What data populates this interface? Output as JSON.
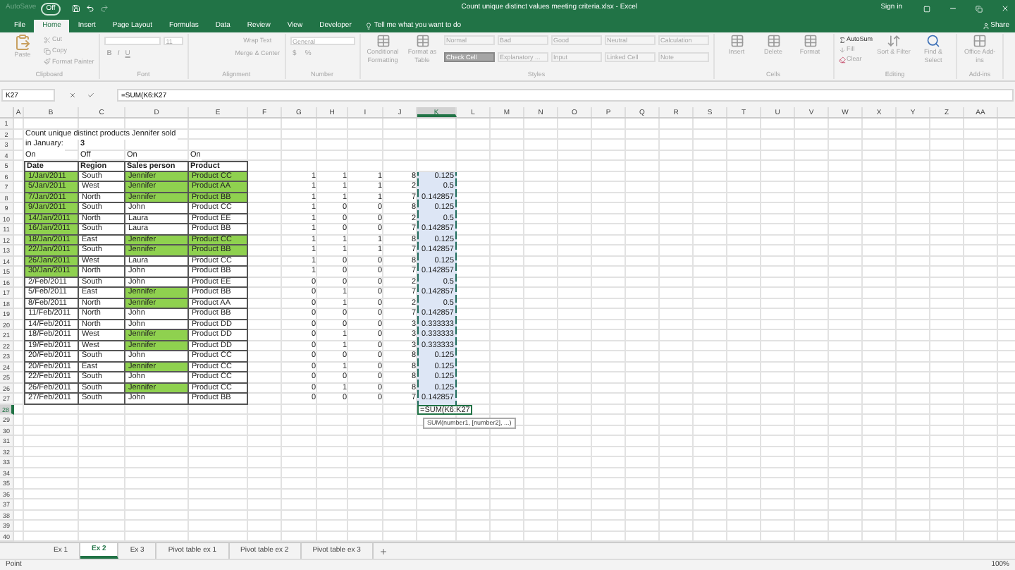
{
  "title_bar": {
    "autosave_label": "AutoSave",
    "autosave_state": "Off",
    "title": "Count unique distinct values meeting criteria.xlsx - Excel",
    "sign_in": "Sign in"
  },
  "ribbon_tabs": [
    {
      "label": "File",
      "selected": false
    },
    {
      "label": "Home",
      "selected": true
    },
    {
      "label": "Insert",
      "selected": false
    },
    {
      "label": "Page Layout",
      "selected": false
    },
    {
      "label": "Formulas",
      "selected": false
    },
    {
      "label": "Data",
      "selected": false
    },
    {
      "label": "Review",
      "selected": false
    },
    {
      "label": "View",
      "selected": false
    },
    {
      "label": "Developer",
      "selected": false
    }
  ],
  "tell_me": "Tell me what you want to do",
  "share": "Share",
  "ribbon": {
    "disabled": true,
    "groups": [
      {
        "kind": "clipboard",
        "label": "Clipboard",
        "big": [
          "Paste"
        ],
        "items": [
          "Cut",
          "Copy",
          "Format Painter"
        ]
      },
      {
        "kind": "font",
        "label": "Font",
        "size": "11",
        "buttons": [
          "B",
          "I",
          "U"
        ]
      },
      {
        "kind": "alignment",
        "label": "Alignment",
        "items": [
          "Wrap Text",
          "Merge & Center"
        ]
      },
      {
        "kind": "number",
        "label": "Number",
        "format": "General",
        "buttons": [
          "$",
          "%"
        ]
      },
      {
        "kind": "styles",
        "label": "Styles",
        "big": [
          "Conditional Formatting",
          "Format as Table"
        ],
        "styles": [
          {
            "label": "Normal",
            "selected": false
          },
          {
            "label": "Bad",
            "selected": false
          },
          {
            "label": "Good",
            "selected": false
          },
          {
            "label": "Neutral",
            "selected": false
          },
          {
            "label": "Calculation",
            "selected": false
          },
          {
            "label": "Check Cell",
            "selected": true
          },
          {
            "label": "Explanatory ...",
            "selected": false
          },
          {
            "label": "Input",
            "selected": false
          },
          {
            "label": "Linked Cell",
            "selected": false
          },
          {
            "label": "Note",
            "selected": false
          }
        ]
      },
      {
        "kind": "cells",
        "label": "Cells",
        "big": [
          "Insert",
          "Delete",
          "Format"
        ]
      },
      {
        "kind": "editing",
        "label": "Editing",
        "items": [
          "AutoSum",
          "Fill",
          "Clear"
        ],
        "big": [
          "Sort & Filter",
          "Find & Select"
        ]
      },
      {
        "kind": "addins",
        "label": "Add-ins",
        "big": [
          "Office Add-ins"
        ]
      }
    ]
  },
  "formula_bar": {
    "name_box": "K27",
    "formula": "=SUM(K6:K27"
  },
  "sheet": {
    "column_headers": [
      {
        "label": "A",
        "selected": false
      },
      {
        "label": "B",
        "selected": false
      },
      {
        "label": "C",
        "selected": false
      },
      {
        "label": "D",
        "selected": false
      },
      {
        "label": "E",
        "selected": false
      },
      {
        "label": "F",
        "selected": false
      },
      {
        "label": "G",
        "selected": false
      },
      {
        "label": "H",
        "selected": false
      },
      {
        "label": "I",
        "selected": false
      },
      {
        "label": "J",
        "selected": false
      },
      {
        "label": "K",
        "selected": true
      },
      {
        "label": "L",
        "selected": false
      },
      {
        "label": "M",
        "selected": false
      },
      {
        "label": "N",
        "selected": false
      },
      {
        "label": "O",
        "selected": false
      },
      {
        "label": "P",
        "selected": false
      },
      {
        "label": "Q",
        "selected": false
      },
      {
        "label": "R",
        "selected": false
      },
      {
        "label": "S",
        "selected": false
      },
      {
        "label": "T",
        "selected": false
      },
      {
        "label": "U",
        "selected": false
      },
      {
        "label": "V",
        "selected": false
      },
      {
        "label": "W",
        "selected": false
      },
      {
        "label": "X",
        "selected": false
      },
      {
        "label": "Y",
        "selected": false
      },
      {
        "label": "Z",
        "selected": false
      },
      {
        "label": "AA",
        "selected": false
      }
    ],
    "rows": [
      {
        "header": "1",
        "selected": false,
        "kind": "blank"
      },
      {
        "header": "2",
        "selected": false,
        "kind": "note",
        "note": "Count unique distinct products  Jennifer sold"
      },
      {
        "header": "3",
        "selected": false,
        "kind": "result",
        "note": "in January:",
        "result": "3"
      },
      {
        "header": "4",
        "selected": false,
        "kind": "toggles",
        "toggles": [
          "On",
          "Off",
          "On",
          "On"
        ]
      },
      {
        "header": "5",
        "selected": false,
        "kind": "table_header",
        "labels": [
          "Date",
          "Region",
          "Sales person",
          "Product"
        ]
      },
      {
        "header": "6",
        "selected": false,
        "kind": "record",
        "marked": true,
        "record": [
          {
            "text": "1/Jan/2011",
            "highlighted": true
          },
          {
            "text": "South",
            "highlighted": false
          },
          {
            "text": "Jennifer",
            "highlighted": true
          },
          {
            "text": "Product CC",
            "highlighted": true
          }
        ],
        "helpers": [
          "1",
          "1",
          "1",
          "8",
          "0.125"
        ]
      },
      {
        "header": "7",
        "selected": false,
        "kind": "record",
        "marked": true,
        "record": [
          {
            "text": "5/Jan/2011",
            "highlighted": true
          },
          {
            "text": "West",
            "highlighted": false
          },
          {
            "text": "Jennifer",
            "highlighted": true
          },
          {
            "text": "Product AA",
            "highlighted": true
          }
        ],
        "helpers": [
          "1",
          "1",
          "1",
          "2",
          "0.5"
        ]
      },
      {
        "header": "8",
        "selected": false,
        "kind": "record",
        "marked": true,
        "record": [
          {
            "text": "7/Jan/2011",
            "highlighted": true
          },
          {
            "text": "North",
            "highlighted": false
          },
          {
            "text": "Jennifer",
            "highlighted": true
          },
          {
            "text": "Product BB",
            "highlighted": true
          }
        ],
        "helpers": [
          "1",
          "1",
          "1",
          "7",
          "0.142857"
        ]
      },
      {
        "header": "9",
        "selected": false,
        "kind": "record",
        "marked": true,
        "record": [
          {
            "text": "9/Jan/2011",
            "highlighted": true
          },
          {
            "text": "South",
            "highlighted": false
          },
          {
            "text": "John",
            "highlighted": false
          },
          {
            "text": "Product CC",
            "highlighted": false
          }
        ],
        "helpers": [
          "1",
          "0",
          "0",
          "8",
          "0.125"
        ]
      },
      {
        "header": "10",
        "selected": false,
        "kind": "record",
        "marked": true,
        "record": [
          {
            "text": "14/Jan/2011",
            "highlighted": true
          },
          {
            "text": "North",
            "highlighted": false
          },
          {
            "text": "Laura",
            "highlighted": false
          },
          {
            "text": "Product EE",
            "highlighted": false
          }
        ],
        "helpers": [
          "1",
          "0",
          "0",
          "2",
          "0.5"
        ]
      },
      {
        "header": "11",
        "selected": false,
        "kind": "record",
        "marked": true,
        "record": [
          {
            "text": "16/Jan/2011",
            "highlighted": true
          },
          {
            "text": "South",
            "highlighted": false
          },
          {
            "text": "Laura",
            "highlighted": false
          },
          {
            "text": "Product BB",
            "highlighted": false
          }
        ],
        "helpers": [
          "1",
          "0",
          "0",
          "7",
          "0.142857"
        ]
      },
      {
        "header": "12",
        "selected": false,
        "kind": "record",
        "marked": true,
        "record": [
          {
            "text": "18/Jan/2011",
            "highlighted": true
          },
          {
            "text": "East",
            "highlighted": false
          },
          {
            "text": "Jennifer",
            "highlighted": true
          },
          {
            "text": "Product CC",
            "highlighted": true
          }
        ],
        "helpers": [
          "1",
          "1",
          "1",
          "8",
          "0.125"
        ]
      },
      {
        "header": "13",
        "selected": false,
        "kind": "record",
        "marked": true,
        "record": [
          {
            "text": "22/Jan/2011",
            "highlighted": true
          },
          {
            "text": "South",
            "highlighted": false
          },
          {
            "text": "Jennifer",
            "highlighted": true
          },
          {
            "text": "Product BB",
            "highlighted": true
          }
        ],
        "helpers": [
          "1",
          "1",
          "1",
          "7",
          "0.142857"
        ]
      },
      {
        "header": "14",
        "selected": false,
        "kind": "record",
        "marked": true,
        "record": [
          {
            "text": "26/Jan/2011",
            "highlighted": true
          },
          {
            "text": "West",
            "highlighted": false
          },
          {
            "text": "Laura",
            "highlighted": false
          },
          {
            "text": "Product CC",
            "highlighted": false
          }
        ],
        "helpers": [
          "1",
          "0",
          "0",
          "8",
          "0.125"
        ]
      },
      {
        "header": "15",
        "selected": false,
        "kind": "record",
        "marked": true,
        "record": [
          {
            "text": "30/Jan/2011",
            "highlighted": true
          },
          {
            "text": "North",
            "highlighted": false
          },
          {
            "text": "John",
            "highlighted": false
          },
          {
            "text": "Product BB",
            "highlighted": false
          }
        ],
        "helpers": [
          "1",
          "0",
          "0",
          "7",
          "0.142857"
        ]
      },
      {
        "header": "16",
        "selected": false,
        "kind": "record",
        "marked": true,
        "record": [
          {
            "text": "2/Feb/2011",
            "highlighted": false
          },
          {
            "text": "South",
            "highlighted": false
          },
          {
            "text": "John",
            "highlighted": false
          },
          {
            "text": "Product EE",
            "highlighted": false
          }
        ],
        "helpers": [
          "0",
          "0",
          "0",
          "2",
          "0.5"
        ]
      },
      {
        "header": "17",
        "selected": false,
        "kind": "record",
        "marked": true,
        "record": [
          {
            "text": "5/Feb/2011",
            "highlighted": false
          },
          {
            "text": "East",
            "highlighted": false
          },
          {
            "text": "Jennifer",
            "highlighted": true
          },
          {
            "text": "Product BB",
            "highlighted": false
          }
        ],
        "helpers": [
          "0",
          "1",
          "0",
          "7",
          "0.142857"
        ]
      },
      {
        "header": "18",
        "selected": false,
        "kind": "record",
        "marked": true,
        "record": [
          {
            "text": "8/Feb/2011",
            "highlighted": false
          },
          {
            "text": "North",
            "highlighted": false
          },
          {
            "text": "Jennifer",
            "highlighted": true
          },
          {
            "text": "Product AA",
            "highlighted": false
          }
        ],
        "helpers": [
          "0",
          "1",
          "0",
          "2",
          "0.5"
        ]
      },
      {
        "header": "19",
        "selected": false,
        "kind": "record",
        "marked": true,
        "record": [
          {
            "text": "11/Feb/2011",
            "highlighted": false
          },
          {
            "text": "North",
            "highlighted": false
          },
          {
            "text": "John",
            "highlighted": false
          },
          {
            "text": "Product BB",
            "highlighted": false
          }
        ],
        "helpers": [
          "0",
          "0",
          "0",
          "7",
          "0.142857"
        ]
      },
      {
        "header": "20",
        "selected": false,
        "kind": "record",
        "marked": true,
        "record": [
          {
            "text": "14/Feb/2011",
            "highlighted": false
          },
          {
            "text": "North",
            "highlighted": false
          },
          {
            "text": "John",
            "highlighted": false
          },
          {
            "text": "Product DD",
            "highlighted": false
          }
        ],
        "helpers": [
          "0",
          "0",
          "0",
          "3",
          "0.333333"
        ]
      },
      {
        "header": "21",
        "selected": false,
        "kind": "record",
        "marked": true,
        "record": [
          {
            "text": "18/Feb/2011",
            "highlighted": false
          },
          {
            "text": "West",
            "highlighted": false
          },
          {
            "text": "Jennifer",
            "highlighted": true
          },
          {
            "text": "Product DD",
            "highlighted": false
          }
        ],
        "helpers": [
          "0",
          "1",
          "0",
          "3",
          "0.333333"
        ]
      },
      {
        "header": "22",
        "selected": false,
        "kind": "record",
        "marked": true,
        "record": [
          {
            "text": "19/Feb/2011",
            "highlighted": false
          },
          {
            "text": "West",
            "highlighted": false
          },
          {
            "text": "Jennifer",
            "highlighted": true
          },
          {
            "text": "Product DD",
            "highlighted": false
          }
        ],
        "helpers": [
          "0",
          "1",
          "0",
          "3",
          "0.333333"
        ]
      },
      {
        "header": "23",
        "selected": false,
        "kind": "record",
        "marked": true,
        "record": [
          {
            "text": "20/Feb/2011",
            "highlighted": false
          },
          {
            "text": "South",
            "highlighted": false
          },
          {
            "text": "John",
            "highlighted": false
          },
          {
            "text": "Product CC",
            "highlighted": false
          }
        ],
        "helpers": [
          "0",
          "0",
          "0",
          "8",
          "0.125"
        ]
      },
      {
        "header": "24",
        "selected": false,
        "kind": "record",
        "marked": true,
        "record": [
          {
            "text": "20/Feb/2011",
            "highlighted": false
          },
          {
            "text": "East",
            "highlighted": false
          },
          {
            "text": "Jennifer",
            "highlighted": true
          },
          {
            "text": "Product CC",
            "highlighted": false
          }
        ],
        "helpers": [
          "0",
          "1",
          "0",
          "8",
          "0.125"
        ]
      },
      {
        "header": "25",
        "selected": false,
        "kind": "record",
        "marked": true,
        "record": [
          {
            "text": "22/Feb/2011",
            "highlighted": false
          },
          {
            "text": "South",
            "highlighted": false
          },
          {
            "text": "John",
            "highlighted": false
          },
          {
            "text": "Product CC",
            "highlighted": false
          }
        ],
        "helpers": [
          "0",
          "0",
          "0",
          "8",
          "0.125"
        ]
      },
      {
        "header": "26",
        "selected": false,
        "kind": "record",
        "marked": true,
        "record": [
          {
            "text": "26/Feb/2011",
            "highlighted": false
          },
          {
            "text": "South",
            "highlighted": false
          },
          {
            "text": "Jennifer",
            "highlighted": true
          },
          {
            "text": "Product CC",
            "highlighted": false
          }
        ],
        "helpers": [
          "0",
          "1",
          "0",
          "8",
          "0.125"
        ]
      },
      {
        "header": "27",
        "selected": false,
        "kind": "record",
        "marked": true,
        "record": [
          {
            "text": "27/Feb/2011",
            "highlighted": false
          },
          {
            "text": "South",
            "highlighted": false
          },
          {
            "text": "John",
            "highlighted": false
          },
          {
            "text": "Product BB",
            "highlighted": false
          }
        ],
        "helpers": [
          "0",
          "0",
          "0",
          "7",
          "0.142857"
        ]
      },
      {
        "header": "28",
        "selected": true,
        "kind": "editing",
        "editing": "=SUM(K6:K27",
        "tooltip": "SUM(number1, [number2], ...)"
      },
      {
        "header": "29",
        "selected": false,
        "kind": "blank"
      },
      {
        "header": "30",
        "selected": false,
        "kind": "blank"
      },
      {
        "header": "31",
        "selected": false,
        "kind": "blank"
      },
      {
        "header": "32",
        "selected": false,
        "kind": "blank"
      },
      {
        "header": "33",
        "selected": false,
        "kind": "blank"
      },
      {
        "header": "34",
        "selected": false,
        "kind": "blank"
      },
      {
        "header": "35",
        "selected": false,
        "kind": "blank"
      },
      {
        "header": "36",
        "selected": false,
        "kind": "blank"
      },
      {
        "header": "37",
        "selected": false,
        "kind": "blank"
      },
      {
        "header": "38",
        "selected": false,
        "kind": "blank"
      },
      {
        "header": "39",
        "selected": false,
        "kind": "blank"
      },
      {
        "header": "40",
        "selected": false,
        "kind": "blank"
      }
    ]
  },
  "sheet_tabs": [
    {
      "label": "Ex 1",
      "selected": false
    },
    {
      "label": "Ex 2",
      "selected": true
    },
    {
      "label": "Ex 3",
      "selected": false
    },
    {
      "label": "Pivot table ex 1",
      "selected": false
    },
    {
      "label": "Pivot table ex 2",
      "selected": false
    },
    {
      "label": "Pivot table ex 3",
      "selected": false
    }
  ],
  "status_bar": {
    "mode": "Point",
    "zoom": "100%"
  }
}
